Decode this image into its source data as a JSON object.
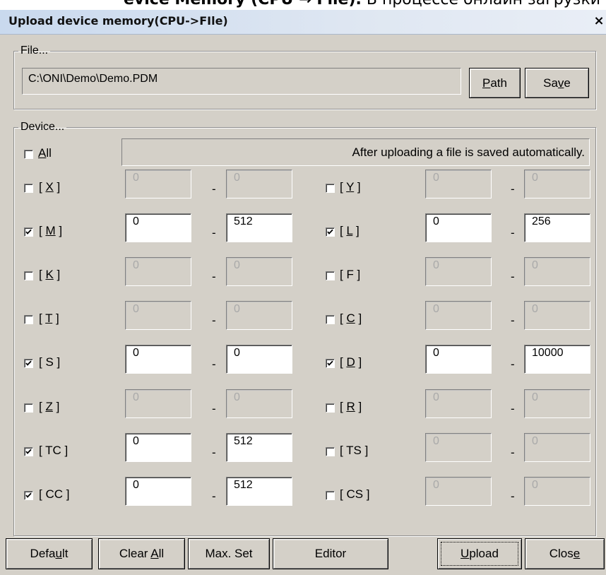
{
  "page_title": {
    "prefix": "evice Memory (CPU ",
    "arrow": "→",
    "bold_tail": "File).",
    "rest": " В процессе онлайн загрузки они копируются"
  },
  "window": {
    "title": "Upload device memory(CPU->FIle)",
    "close_glyph": "×"
  },
  "file": {
    "legend": "File...",
    "path": "C:\\ONI\\Demo\\Demo.PDM",
    "path_button": {
      "hot": "P",
      "rest": "ath"
    },
    "save_button": {
      "pre": "Sa",
      "hot": "v",
      "rest": "e"
    }
  },
  "device": {
    "legend": "Device...",
    "all": {
      "hot": "A",
      "rest": "ll",
      "checked": false
    },
    "info": "After uploading a file is saved automatically.",
    "rows": [
      {
        "left": {
          "pre": "[ ",
          "hot": "X",
          "post": " ]",
          "checked": false,
          "from": "0",
          "to": "0"
        },
        "right": {
          "pre": "[ ",
          "hot": "Y",
          "post": " ]",
          "checked": false,
          "from": "0",
          "to": "0"
        }
      },
      {
        "left": {
          "pre": "[ ",
          "hot": "M",
          "post": " ]",
          "checked": true,
          "from": "0",
          "to": "512"
        },
        "right": {
          "pre": "[ ",
          "hot": "L",
          "post": " ]",
          "checked": true,
          "from": "0",
          "to": "256"
        }
      },
      {
        "left": {
          "pre": "[ ",
          "hot": "K",
          "post": " ]",
          "checked": false,
          "from": "0",
          "to": "0"
        },
        "right": {
          "pre": "[ F ]",
          "hot": "",
          "post": "",
          "checked": false,
          "from": "0",
          "to": "0"
        }
      },
      {
        "left": {
          "pre": "[ ",
          "hot": "T",
          "post": " ]",
          "checked": false,
          "from": "0",
          "to": "0"
        },
        "right": {
          "pre": "[ ",
          "hot": "C",
          "post": " ]",
          "checked": false,
          "from": "0",
          "to": "0"
        }
      },
      {
        "left": {
          "pre": "[ S ]",
          "hot": "",
          "post": "",
          "checked": true,
          "from": "0",
          "to": "0"
        },
        "right": {
          "pre": "[ ",
          "hot": "D",
          "post": " ]",
          "checked": true,
          "from": "0",
          "to": "10000"
        }
      },
      {
        "left": {
          "pre": "[ ",
          "hot": "Z",
          "post": " ]",
          "checked": false,
          "from": "0",
          "to": "0"
        },
        "right": {
          "pre": "[ ",
          "hot": "R",
          "post": " ]",
          "checked": false,
          "from": "0",
          "to": "0"
        }
      },
      {
        "left": {
          "pre": "[ TC ]",
          "hot": "",
          "post": "",
          "checked": true,
          "from": "0",
          "to": "512"
        },
        "right": {
          "pre": "[ TS ]",
          "hot": "",
          "post": "",
          "checked": false,
          "from": "0",
          "to": "0"
        }
      },
      {
        "left": {
          "pre": "[ CC  ]",
          "hot": "",
          "post": "",
          "checked": true,
          "from": "0",
          "to": "512"
        },
        "right": {
          "pre": "[ CS ]",
          "hot": "",
          "post": "",
          "checked": false,
          "from": "0",
          "to": "0"
        }
      }
    ],
    "range_separator": "-"
  },
  "footer": {
    "default": {
      "pre": "Defa",
      "hot": "u",
      "rest": "lt"
    },
    "clear_all": {
      "pre": "Clear ",
      "hot": "A",
      "rest": "ll"
    },
    "max_set": "Max. Set",
    "editor": "Editor",
    "upload": {
      "pre": "",
      "hot": "U",
      "rest": "pload"
    },
    "close": {
      "pre": "Clos",
      "hot": "e",
      "rest": ""
    }
  }
}
